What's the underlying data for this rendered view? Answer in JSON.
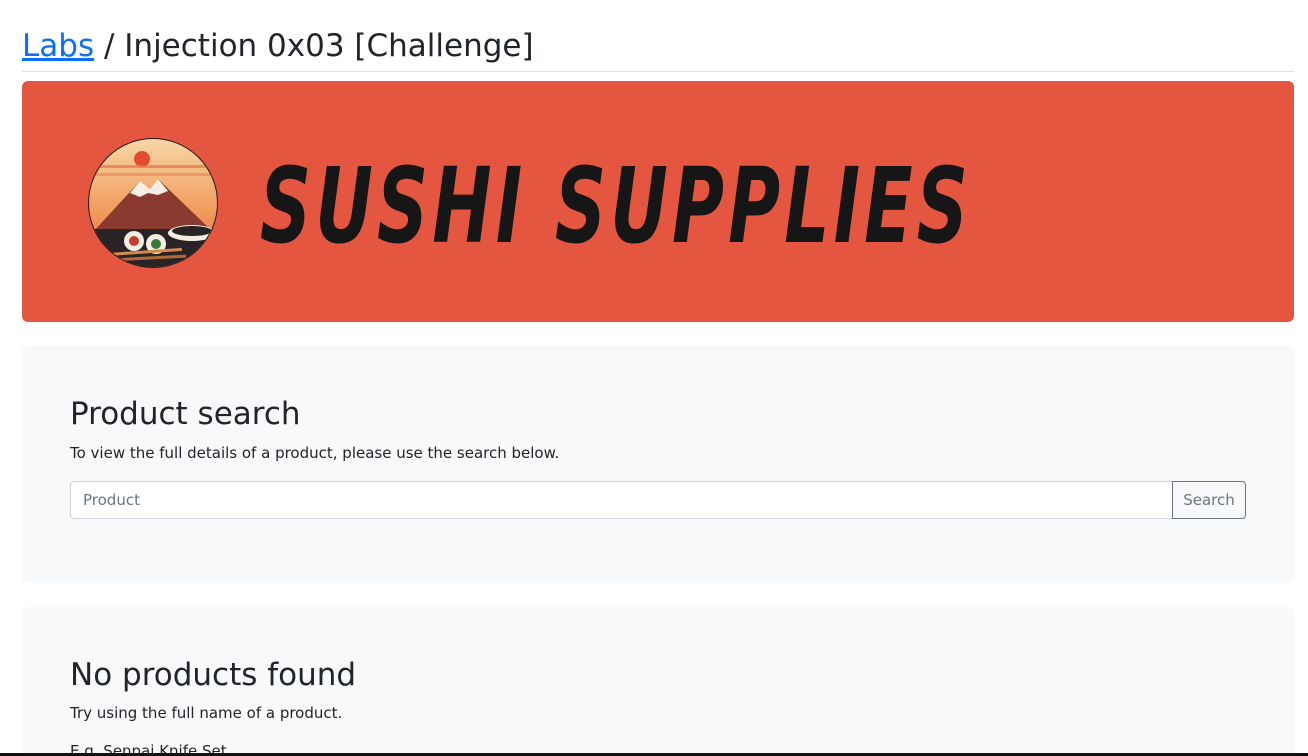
{
  "header": {
    "breadcrumb_link": "Labs",
    "separator": "/",
    "title": "Injection 0x03 [Challenge]"
  },
  "banner": {
    "logo_text": "SUSHI SUPPLIES",
    "colors": {
      "background": "#e45640",
      "text": "#161616"
    },
    "logo_icon": "mountain-sunset-sushi-emblem"
  },
  "search": {
    "heading": "Product search",
    "description": "To view the full details of a product, please use the search below.",
    "input_placeholder": "Product",
    "input_value": "",
    "button_label": "Search"
  },
  "results": {
    "heading": "No products found",
    "hint": "Try using the full name of a product.",
    "example": "E.g. Senpai Knife Set"
  },
  "colors": {
    "link": "#0d6efd",
    "card_background": "#f8f9fa",
    "muted": "#6c757d"
  }
}
